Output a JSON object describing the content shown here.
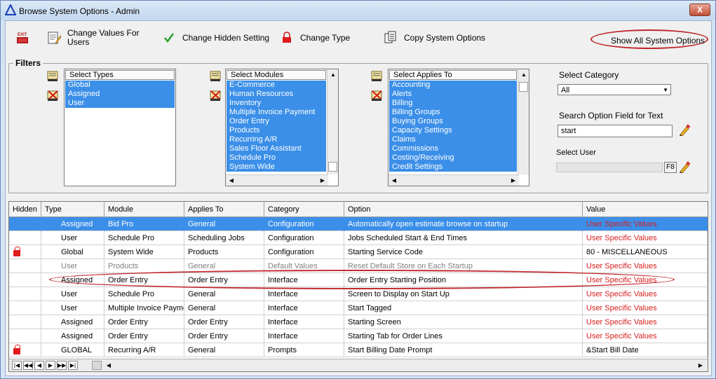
{
  "window": {
    "title": "Browse System Options - Admin",
    "close": "X"
  },
  "toolbar": {
    "exit": "EXIT",
    "change_values": "Change Values For\nUsers",
    "change_hidden": "Change Hidden Setting",
    "change_type": "Change Type",
    "copy_options": "Copy System Options",
    "show_all": "Show All System Options"
  },
  "filters": {
    "legend": "Filters",
    "types": {
      "header": "Select Types",
      "items": [
        "Global",
        "Assigned",
        "User"
      ]
    },
    "modules": {
      "header": "Select Modules",
      "items": [
        "E-Commerce",
        "Human Resources",
        "Inventory",
        "Multiple Invoice Payment",
        "Order Entry",
        "Products",
        "Recurring A/R",
        "Sales Floor Assistant",
        "Schedule Pro",
        "System Wide"
      ]
    },
    "applies": {
      "header": "Select Applies To",
      "items": [
        "Accounting",
        "Alerts",
        "Billing",
        "Billing Groups",
        "Buying Groups",
        "Capacity Settings",
        "Claims",
        "Commissions",
        "Costing/Receiving",
        "Credit Settings"
      ]
    },
    "category_label": "Select Category",
    "category_value": "All",
    "search_label": "Search Option Field for Text",
    "search_value": "start",
    "user_label": "Select User",
    "user_value": "",
    "f8": "F8"
  },
  "grid": {
    "columns": [
      "Hidden",
      "Type",
      "Module",
      "Applies To",
      "Category",
      "Option",
      "Value"
    ],
    "rows": [
      {
        "hidden": "",
        "type": "Assigned",
        "module": "Bid Pro",
        "applies": "General",
        "category": "Configuration",
        "option": "Automatically open estimate browse on startup",
        "value": "User Specific Values",
        "lock": false,
        "style": "sel"
      },
      {
        "hidden": "",
        "type": "User",
        "module": "Schedule Pro",
        "applies": "Scheduling Jobs",
        "category": "Configuration",
        "option": "Jobs Scheduled Start & End Times",
        "value": "User Specific Values",
        "lock": false,
        "style": ""
      },
      {
        "hidden": "",
        "type": "Global",
        "module": "System Wide",
        "applies": "Products",
        "category": "Configuration",
        "option": "Starting Service Code",
        "value": "80 - MISCELLANEOUS",
        "lock": true,
        "style": ""
      },
      {
        "hidden": "",
        "type": "User",
        "module": "Products",
        "applies": "General",
        "category": "Default Values",
        "option": "Reset Default Store on Each Startup",
        "value": "User Specific Values",
        "lock": false,
        "style": "gray"
      },
      {
        "hidden": "",
        "type": "Assigned",
        "module": "Order Entry",
        "applies": "Order Entry",
        "category": "Interface",
        "option": "Order Entry Starting Position",
        "value": "User Specific Values",
        "lock": false,
        "style": ""
      },
      {
        "hidden": "",
        "type": "User",
        "module": "Schedule Pro",
        "applies": "General",
        "category": "Interface",
        "option": "Screen to Display on Start Up",
        "value": "User Specific Values",
        "lock": false,
        "style": ""
      },
      {
        "hidden": "",
        "type": "User",
        "module": "Multiple Invoice Payme",
        "applies": "General",
        "category": "Interface",
        "option": "Start Tagged",
        "value": "User Specific Values",
        "lock": false,
        "style": ""
      },
      {
        "hidden": "",
        "type": "Assigned",
        "module": "Order Entry",
        "applies": "Order Entry",
        "category": "Interface",
        "option": "Starting Screen",
        "value": "User Specific Values",
        "lock": false,
        "style": ""
      },
      {
        "hidden": "",
        "type": "Assigned",
        "module": "Order Entry",
        "applies": "Order Entry",
        "category": "Interface",
        "option": "Starting Tab for Order Lines",
        "value": "User Specific Values",
        "lock": false,
        "style": ""
      },
      {
        "hidden": "",
        "type": "GLOBAL",
        "module": "Recurring A/R",
        "applies": "General",
        "category": "Prompts",
        "option": "Start Billing Date Prompt",
        "value": "&Start Bill Date",
        "lock": true,
        "style": ""
      }
    ],
    "nav": [
      "|◀",
      "◀◀",
      "◀",
      "▶",
      "▶▶",
      "▶|"
    ]
  }
}
